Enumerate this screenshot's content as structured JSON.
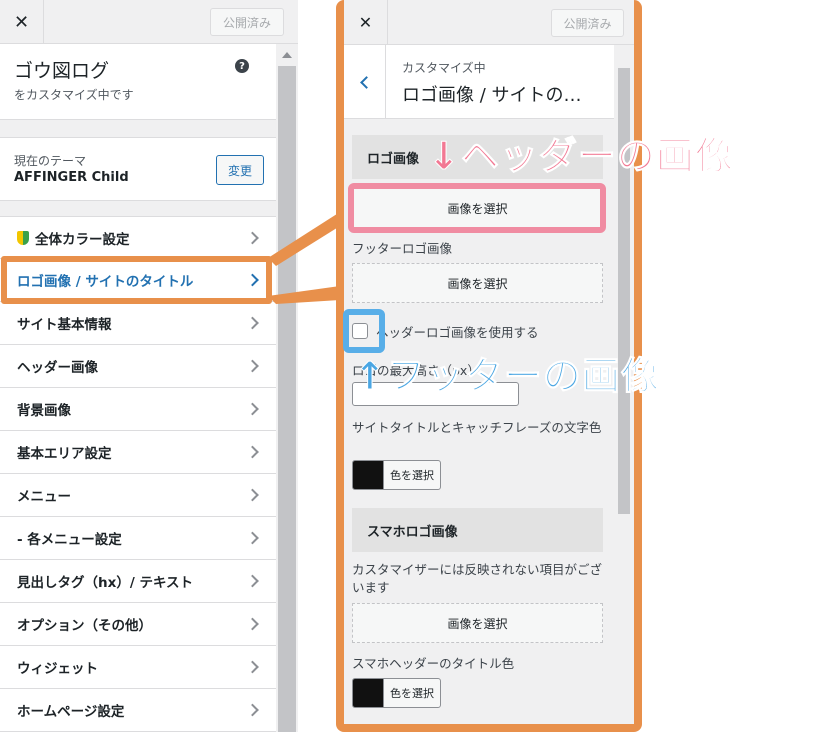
{
  "left_panel": {
    "close_label": "✕",
    "publish_label": "公開済み",
    "site_title": "ゴウ図ログ",
    "site_subtitle": "をカスタマイズ中です",
    "help_label": "?",
    "theme_label": "現在のテーマ",
    "theme_name": "AFFINGER Child",
    "theme_change_label": "変更",
    "menu": [
      {
        "label": "全体カラー設定"
      },
      {
        "label": "ロゴ画像 / サイトのタイトル"
      },
      {
        "label": "サイト基本情報"
      },
      {
        "label": "ヘッダー画像"
      },
      {
        "label": "背景画像"
      },
      {
        "label": "基本エリア設定"
      },
      {
        "label": "メニュー"
      },
      {
        "label": "- 各メニュー設定"
      },
      {
        "label": "見出しタグ（hx）/ テキスト"
      },
      {
        "label": "オプション（その他）"
      },
      {
        "label": "ウィジェット"
      },
      {
        "label": "ホームページ設定"
      }
    ]
  },
  "right_panel": {
    "close_label": "✕",
    "publish_label": "公開済み",
    "customizing_label": "カスタマイズ中",
    "section_title": "ロゴ画像 / サイトの…",
    "logo_group_label": "ロゴ画像",
    "logo_select_label": "画像を選択",
    "footer_logo_label": "フッターロゴ画像",
    "footer_logo_select_label": "画像を選択",
    "use_header_logo_label": "ヘッダーロゴ画像を使用する",
    "max_height_label": "ロゴの最大高さ（px）",
    "title_color_label": "サイトタイトルとキャッチフレーズの文字色",
    "title_color_button": "色を選択",
    "sp_group_label": "スマホロゴ画像",
    "sp_note": "カスタマイザーには反映されない項目がございます",
    "sp_select_label": "画像を選択",
    "sp_title_color_label": "スマホヘッダーのタイトル色",
    "sp_title_color_button": "色を選択"
  },
  "annotations": {
    "header_image": "↓ヘッダーの画像",
    "footer_image": "↑フッターの画像"
  },
  "colors": {
    "highlight_orange": "#e8904b",
    "header_pink": "#f27893",
    "footer_blue": "#4aa6e3",
    "wp_blue": "#2271b1"
  }
}
